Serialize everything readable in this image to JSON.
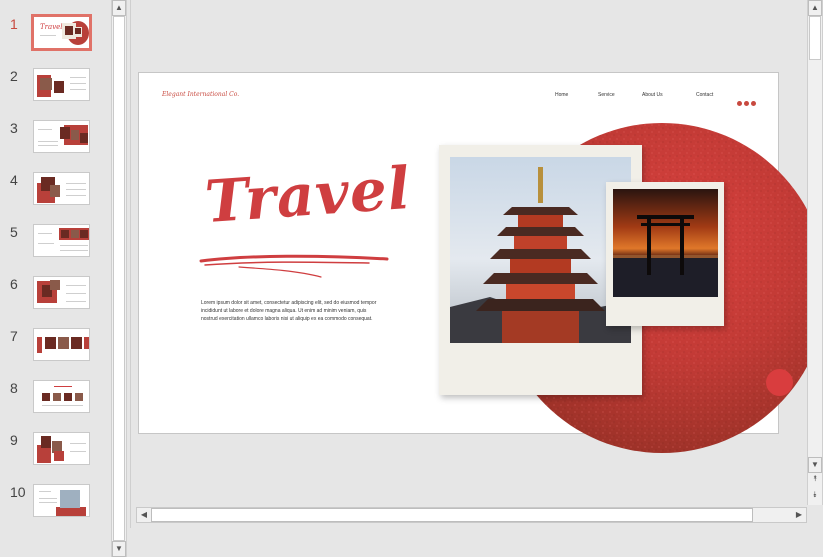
{
  "thumbnails": [
    {
      "number": "1",
      "active": true
    },
    {
      "number": "2",
      "active": false
    },
    {
      "number": "3",
      "active": false
    },
    {
      "number": "4",
      "active": false
    },
    {
      "number": "5",
      "active": false
    },
    {
      "number": "6",
      "active": false
    },
    {
      "number": "7",
      "active": false
    },
    {
      "number": "8",
      "active": false
    },
    {
      "number": "9",
      "active": false
    },
    {
      "number": "10",
      "active": false
    }
  ],
  "slide": {
    "logo": "Elegant International Co.",
    "nav": [
      "Home",
      "Service",
      "About Us",
      "Contact"
    ],
    "title": "Travel",
    "body": "Lorem ipsum dolor sit amet, consectetur adipiscing elit, sed do eiusmod tempor incididunt ut labore et dolore magna aliqua. Ut enim ad minim veniam, quis nostrud exercitation ullamco laboris nisi ut aliquip ex ea commodo consequat."
  },
  "icons": {
    "scroll_up": "▲",
    "scroll_down": "▼",
    "scroll_left": "◀",
    "scroll_right": "▶",
    "page_up": "⯭",
    "page_down": "⯯"
  },
  "colors": {
    "accent": "#cf3e40",
    "dark_red": "#8a2d23",
    "active_thumb_border": "#e07268"
  }
}
